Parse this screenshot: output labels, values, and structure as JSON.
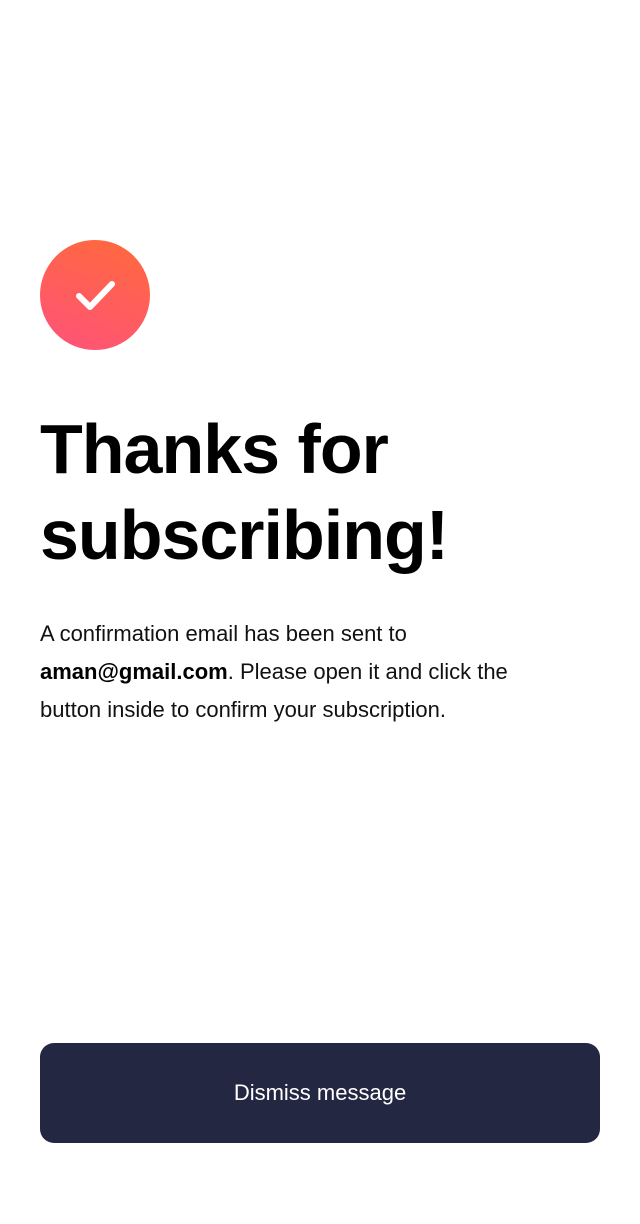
{
  "success": {
    "icon": "checkmark-icon",
    "gradient_start": "#ff6a3a",
    "gradient_end": "#ff527b"
  },
  "heading": {
    "title": "Thanks for subscribing!"
  },
  "message": {
    "prefix": "A confirmation email has been sent to ",
    "email": "aman@gmail.com",
    "suffix": ". Please open it and click the button inside to confirm your subscription."
  },
  "actions": {
    "dismiss_label": "Dismiss message",
    "button_color": "#242742"
  }
}
